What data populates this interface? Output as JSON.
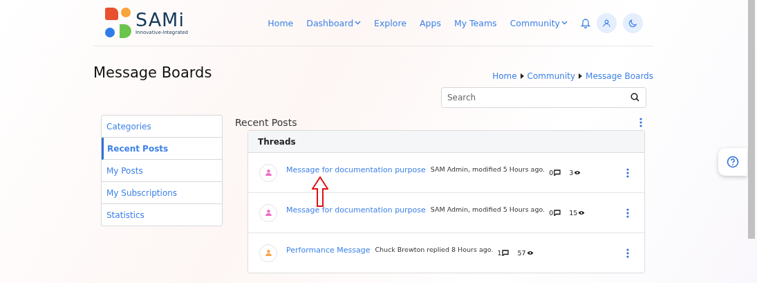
{
  "brand": {
    "name": "SAMi",
    "tagline": "Innovative-Integrated"
  },
  "nav": [
    {
      "label": "Home",
      "dropdown": false
    },
    {
      "label": "Dashboard",
      "dropdown": true
    },
    {
      "label": "Explore",
      "dropdown": false
    },
    {
      "label": "Apps",
      "dropdown": false
    },
    {
      "label": "My Teams",
      "dropdown": false
    },
    {
      "label": "Community",
      "dropdown": true
    }
  ],
  "page_title": "Message Boards",
  "breadcrumb": [
    "Home",
    "Community",
    "Message Boards"
  ],
  "search": {
    "placeholder": "Search"
  },
  "sidebar": [
    {
      "label": "Categories",
      "selected": false
    },
    {
      "label": "Recent Posts",
      "selected": true
    },
    {
      "label": "My Posts",
      "selected": false
    },
    {
      "label": "My Subscriptions",
      "selected": false
    },
    {
      "label": "Statistics",
      "selected": false
    }
  ],
  "section_title": "Recent Posts",
  "threads": {
    "header": "Threads",
    "rows": [
      {
        "title": "Message for documentation purpose",
        "meta": "SAM Admin, modified 5 Hours ago.",
        "replies": "0",
        "views": "3",
        "color": "#f06bc4",
        "annotated": true
      },
      {
        "title": "Message for documentation purpose",
        "meta": "SAM Admin, modified 5 Hours ago.",
        "replies": "0",
        "views": "15",
        "color": "#f06bc4",
        "annotated": false
      },
      {
        "title": "Performance Message",
        "meta": "Chuck Brewton replied 8 Hours ago.",
        "replies": "1",
        "views": "57",
        "color": "#f7a54a",
        "annotated": false
      }
    ]
  }
}
